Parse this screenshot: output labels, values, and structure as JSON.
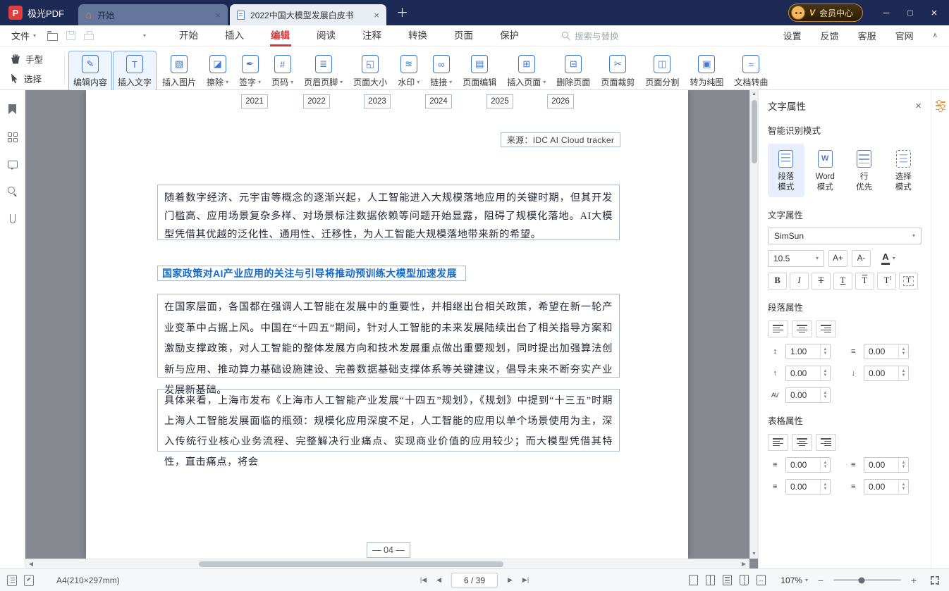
{
  "icons": {
    "home": "⌂",
    "close": "×",
    "plus": "＋",
    "min": "─",
    "max": "□",
    "caret_down": "▾",
    "collapse": "∧",
    "first": "|◀",
    "prev": "◀",
    "next": "▶",
    "last": "▶|",
    "spin_up": "▲",
    "spin_down": "▼",
    "scroll_left": "◀",
    "scroll_right": "▶",
    "scroll_up": "▲",
    "scroll_down": "▼"
  },
  "titlebar": {
    "app_name": "极光PDF",
    "logo_letter": "P",
    "tabs": [
      {
        "label": "开始"
      },
      {
        "label": "2022中国大模型发展白皮书"
      }
    ],
    "member_v": "V",
    "member_label": "会员中心"
  },
  "menubar": {
    "file_label": "文件",
    "items": [
      "开始",
      "插入",
      "编辑",
      "阅读",
      "注释",
      "转换",
      "页面",
      "保护"
    ],
    "search_placeholder": "搜索与替换",
    "right_items": [
      "设置",
      "反馈",
      "客服",
      "官网"
    ]
  },
  "tools": {
    "hand": "手型",
    "select": "选择"
  },
  "ribbon": {
    "buttons": [
      {
        "label": "编辑内容",
        "glyph": "✎"
      },
      {
        "label": "插入文字",
        "glyph": "T"
      },
      {
        "label": "插入图片",
        "glyph": "▧"
      },
      {
        "label": "擦除",
        "glyph": "◪"
      },
      {
        "label": "签字",
        "glyph": "✒"
      },
      {
        "label": "页码",
        "glyph": "#"
      },
      {
        "label": "页眉页脚",
        "glyph": "≣"
      },
      {
        "label": "页面大小",
        "glyph": "◱"
      },
      {
        "label": "水印",
        "glyph": "≋"
      },
      {
        "label": "链接",
        "glyph": "∞"
      },
      {
        "label": "页面编辑",
        "glyph": "▤"
      },
      {
        "label": "插入页面",
        "glyph": "⊞"
      },
      {
        "label": "删除页面",
        "glyph": "⊟"
      },
      {
        "label": "页面裁剪",
        "glyph": "✂"
      },
      {
        "label": "页面分割",
        "glyph": "◫"
      },
      {
        "label": "转为纯图",
        "glyph": "▣"
      },
      {
        "label": "文档转曲",
        "glyph": "≈"
      }
    ]
  },
  "document": {
    "chart_x_labels": [
      "2021",
      "2022",
      "2023",
      "2024",
      "2025",
      "2026"
    ],
    "source_note": "来源：IDC AI Cloud tracker",
    "paragraph_1": "随着数字经济、元宇宙等概念的逐渐兴起，人工智能进入大规模落地应用的关键时期，但其开发门槛高、应用场景复杂多样、对场景标注数据依赖等问题开始显露，阻碍了规模化落地。AI大模型凭借其优越的泛化性、通用性、迁移性，为人工智能大规模落地带来新的希望。",
    "section_heading": "国家政策对AI产业应用的关注与引导将推动预训练大模型加速发展",
    "paragraph_2": "在国家层面，各国都在强调人工智能在发展中的重要性，并相继出台相关政策，希望在新一轮产业变革中占据上风。中国在“十四五”期间，针对人工智能的未来发展陆续出台了相关指导方案和激励支撑政策，对人工智能的整体发展方向和技术发展重点做出重要规划，同时提出加强算法创新与应用、推动算力基础设施建设、完善数据基础支撑体系等关键建议，倡导未来不断夯实产业发展新基础。",
    "paragraph_3": "具体来看，上海市发布《上海市人工智能产业发展“十四五”规划》，《规划》中提到“十三五”时期上海人工智能发展面临的瓶颈：规模化应用深度不足，人工智能的应用以单个场景使用为主，深入传统行业核心业务流程、完整解决行业痛点、实现商业价值的应用较少；而大模型凭借其特性，直击痛点，将会",
    "page_number_label": "— 04 —"
  },
  "panel": {
    "title": "文字属性",
    "section_smart": "智能识别模式",
    "modes": [
      {
        "l1": "段落",
        "l2": "模式"
      },
      {
        "l1": "Word",
        "l2": "模式"
      },
      {
        "l1": "行",
        "l2": "优先"
      },
      {
        "l1": "选择",
        "l2": "模式"
      }
    ],
    "section_text": "文字属性",
    "font_family": "SimSun",
    "font_size": "10.5",
    "size_up": "A+",
    "size_down": "A-",
    "color_label": "A",
    "format": [
      "B",
      "I",
      "T",
      "T",
      "T",
      "T",
      "T"
    ],
    "section_para": "段落属性",
    "section_table": "表格属性",
    "icons": {
      "line_spacing": "↕",
      "indent": "≡",
      "space_before": "↑",
      "space_after": "↓",
      "char_spacing": "AV",
      "cell_a": "≡",
      "cell_b": "≡",
      "cell_c": "≡",
      "cell_d": "≡"
    },
    "values": {
      "line_spacing": "1.00",
      "indent": "0.00",
      "space_before": "0.00",
      "space_after": "0.00",
      "char_spacing": "0.00",
      "table_a": "0.00",
      "table_b": "0.00",
      "table_c": "0.00",
      "table_d": "0.00"
    }
  },
  "statusbar": {
    "page_size_label": "A4(210×297mm)",
    "page_indicator": "6 / 39",
    "zoom_level": "107%"
  }
}
